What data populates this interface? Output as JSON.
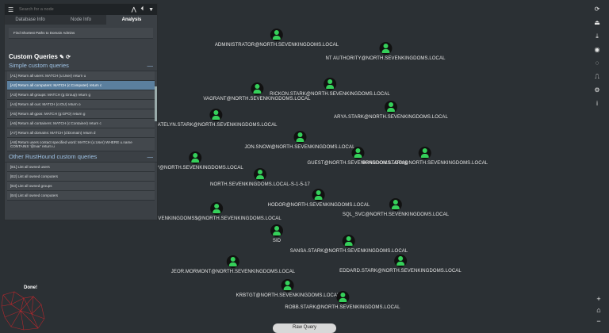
{
  "search": {
    "placeholder": "Search for a node"
  },
  "tabs": [
    "Database Info",
    "Node Info",
    "Analysis"
  ],
  "analysis": {
    "top_query": "Find Shortest Paths to Domain Admins",
    "custom_title": "Custom Queries",
    "simple_title": "Simple custom queries",
    "simple_items": [
      "[A1] Return all users: MATCH (u:User) return u",
      "[A2] Return all computers: MATCH (c:Computer) return c",
      "[A3] Return all groups: MATCH (g:Group) return g",
      "[A4] Return all ous: MATCH (o:OU) return o",
      "[A5] Return all gpos: MATCH (g:GPO) return g",
      "[A6] Return all containers: MATCH (c:Container) return c",
      "[A7] Return all domains: MATCH (d:Domain) return d",
      "[A8] Return users contact specified word: MATCH (u:User) WHERE u.name CONTAINS '@Ivar' return u"
    ],
    "other_title": "Other RustHound custom queries",
    "other_items": [
      "[B1] List all owned users",
      "[B2] List all owned computers",
      "[B3] List all owned groups",
      "[B4] List all owned computers"
    ]
  },
  "nodes": [
    {
      "label": "ADMINISTRATOR@NORTH.SEVENKINGDOMS.LOCAL"
    },
    {
      "label": "NT AUTHORITY@NORTH.SEVENKINGDOMS.LOCAL"
    },
    {
      "label": "RICKON.STARK@NORTH.SEVENKINGDOMS.LOCAL"
    },
    {
      "label": "VAGRANT@NORTH.SEVENKINGDOMS.LOCAL"
    },
    {
      "label": "ARYA.STARK@NORTH.SEVENKINGDOMS.LOCAL"
    },
    {
      "label": "CATELYN.STARK@NORTH.SEVENKINGDOMS.LOCAL"
    },
    {
      "label": "JON.SNOW@NORTH.SEVENKINGDOMS.LOCAL"
    },
    {
      "label": "GUEST@NORTH.SEVENKINGDOMS.LOCAL"
    },
    {
      "label": "BRANDON.STARK@NORTH.SEVENKINGDOMS.LOCAL"
    },
    {
      "label": "ARLY@NORTH.SEVENKINGDOMS.LOCAL"
    },
    {
      "label": "NORTH.SEVENKINGDOMS.LOCAL-S-1-5-17"
    },
    {
      "label": "HODOR@NORTH.SEVENKINGDOMS.LOCAL"
    },
    {
      "label": "SQL_SVC@NORTH.SEVENKINGDOMS.LOCAL"
    },
    {
      "label": "SEVENKINGDOMS$@NORTH.SEVENKINGDOMS.LOCAL"
    },
    {
      "label": "SID"
    },
    {
      "label": "SANSA.STARK@NORTH.SEVENKINGDOMS.LOCAL"
    },
    {
      "label": "JEOR.MORMONT@NORTH.SEVENKINGDOMS.LOCAL"
    },
    {
      "label": "EDDARD.STARK@NORTH.SEVENKINGDOMS.LOCAL"
    },
    {
      "label": "KRBTGT@NORTH.SEVENKINGDOMS.LOCAL"
    },
    {
      "label": "ROBB.STARK@NORTH.SEVENKINGDOMS.LOCAL"
    }
  ],
  "status": "Done!",
  "raw_query_label": "Raw Query"
}
